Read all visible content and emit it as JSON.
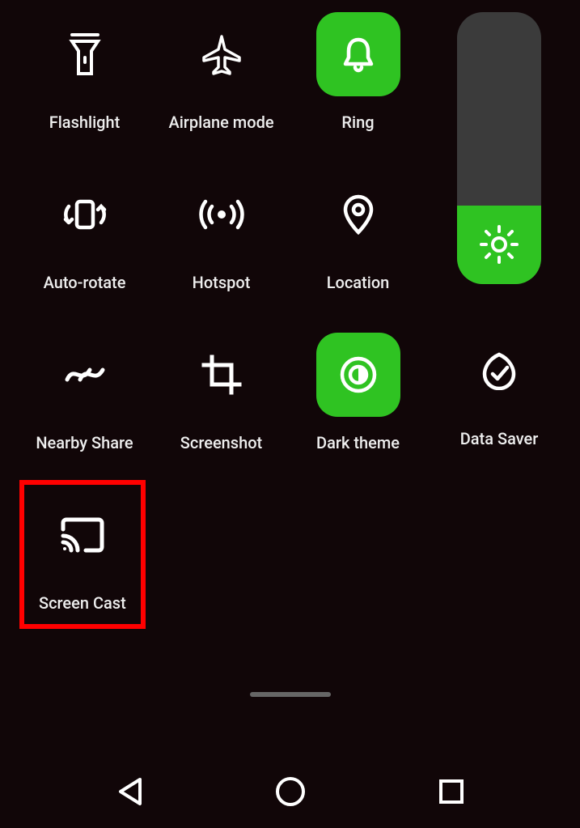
{
  "tiles": {
    "flashlight": {
      "label": "Flashlight",
      "active": false
    },
    "airplane": {
      "label": "Airplane mode",
      "active": false
    },
    "ring": {
      "label": "Ring",
      "active": true
    },
    "autorotate": {
      "label": "Auto-rotate",
      "active": false
    },
    "hotspot": {
      "label": "Hotspot",
      "active": false
    },
    "location": {
      "label": "Location",
      "active": false
    },
    "nearby": {
      "label": "Nearby Share",
      "active": false
    },
    "screenshot": {
      "label": "Screenshot",
      "active": false
    },
    "darktheme": {
      "label": "Dark theme",
      "active": true
    },
    "datasaver": {
      "label": "Data Saver",
      "active": false
    },
    "screencast": {
      "label": "Screen Cast",
      "active": false
    }
  },
  "brightness": {
    "percent": 29
  },
  "highlight": "screencast",
  "colors": {
    "accent": "#2fc322",
    "highlight": "#ff0000"
  }
}
